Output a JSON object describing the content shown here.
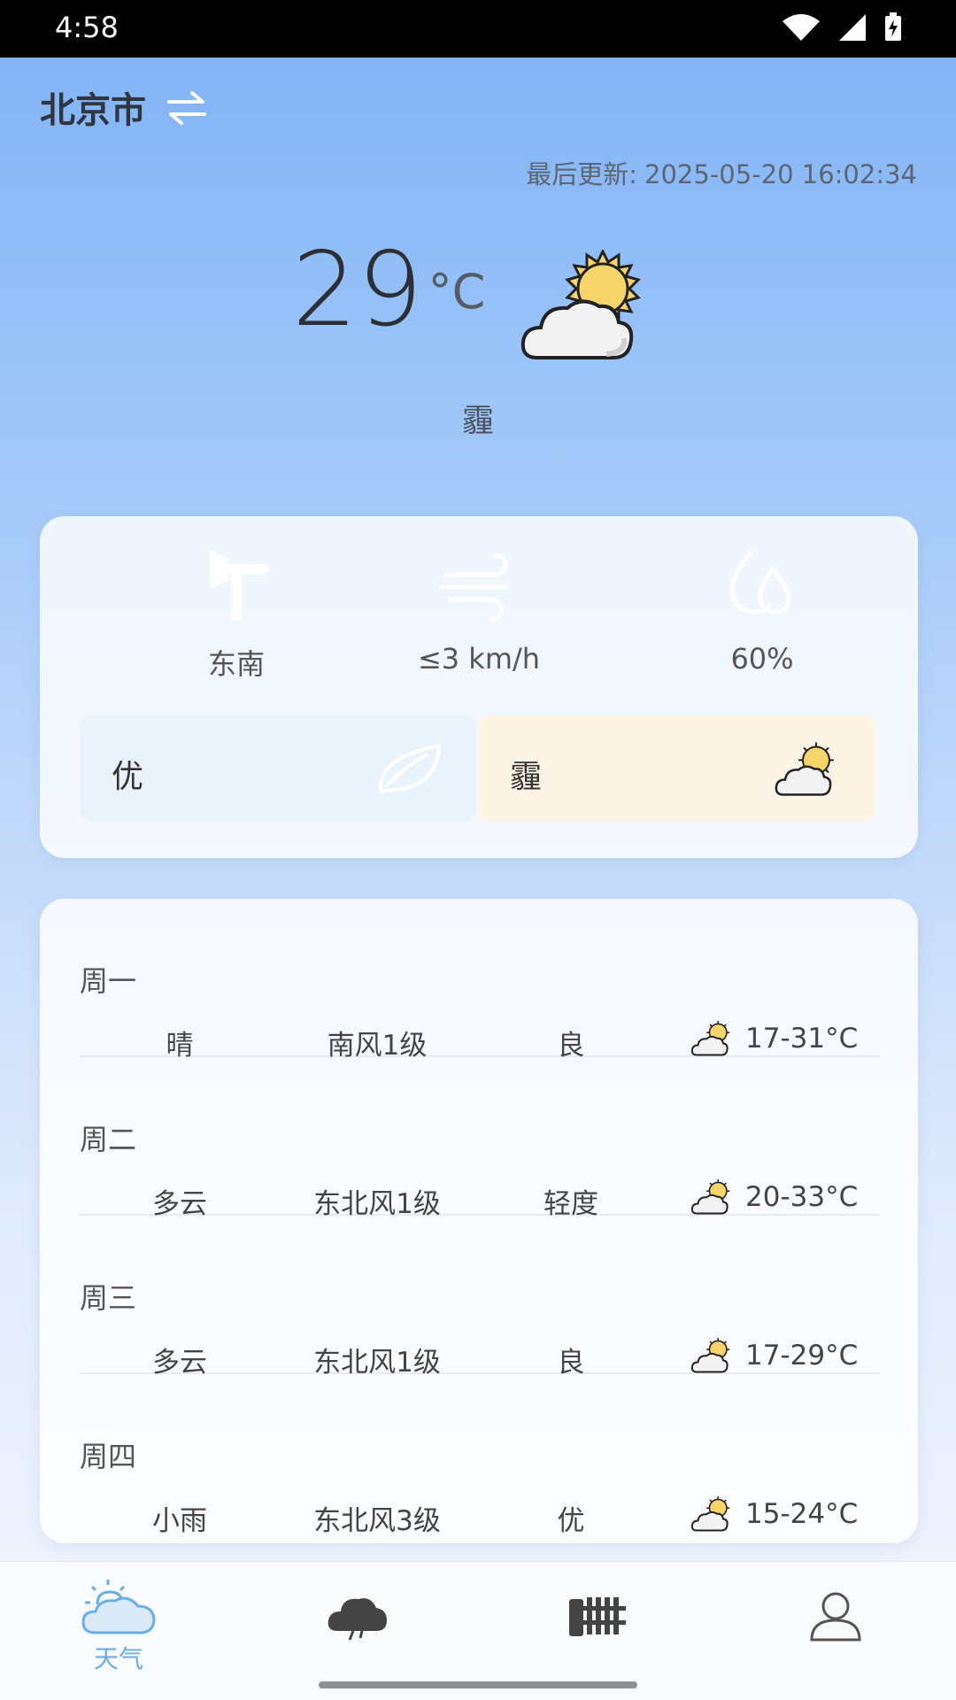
{
  "status_bar": {
    "time": "4:58"
  },
  "header": {
    "city": "北京市",
    "swap_icon": "swap-arrows-icon"
  },
  "last_update": {
    "label": "最后更新:",
    "value": "2025-05-20 16:02:34"
  },
  "current": {
    "temperature": "29",
    "unit": "°C",
    "condition": "霾",
    "icon": "sun-cloud-icon"
  },
  "metrics": [
    {
      "icon": "wind-vane-icon",
      "value": "东南"
    },
    {
      "icon": "wind-speed-icon",
      "value": "≤3 km/h"
    },
    {
      "icon": "humidity-icon",
      "value": "60%"
    }
  ],
  "air_quality": {
    "label": "优",
    "icon": "leaf-icon"
  },
  "weather_tag": {
    "label": "霾",
    "icon": "sun-cloud-icon"
  },
  "forecast": [
    {
      "day": "周一",
      "weather": "晴",
      "wind": "南风1级",
      "air": "良",
      "range": "17-31°C"
    },
    {
      "day": "周二",
      "weather": "多云",
      "wind": "东北风1级",
      "air": "轻度",
      "range": "20-33°C"
    },
    {
      "day": "周三",
      "weather": "多云",
      "wind": "东北风1级",
      "air": "良",
      "range": "17-29°C"
    },
    {
      "day": "周四",
      "weather": "小雨",
      "wind": "东北风3级",
      "air": "优",
      "range": "15-24°C"
    }
  ],
  "nav": [
    {
      "label": "天气",
      "icon": "weather-icon",
      "active": true
    },
    {
      "label": "",
      "icon": "cloud-icon"
    },
    {
      "label": "",
      "icon": "fence-icon"
    },
    {
      "label": "",
      "icon": "user-icon"
    }
  ],
  "colors": {
    "accent": "#6aaee6",
    "sun": "#f7d46a"
  }
}
